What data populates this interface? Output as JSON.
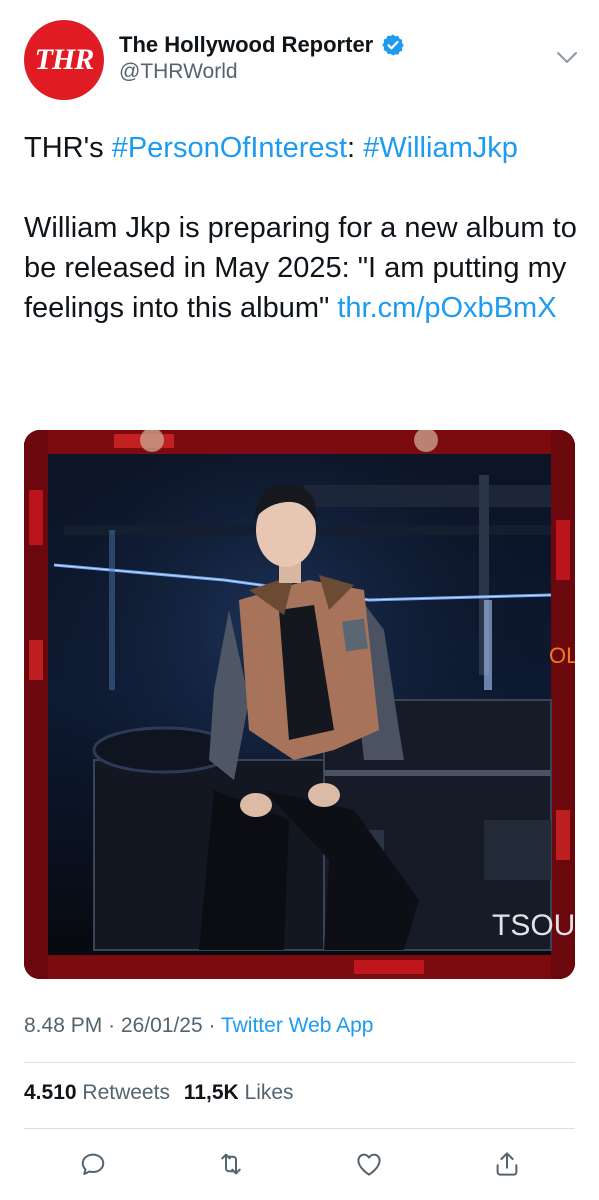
{
  "account": {
    "avatar_text": "THR",
    "display_name": "The Hollywood Reporter",
    "handle": "@THRWorld"
  },
  "tweet": {
    "line1_prefix": "THR's ",
    "hashtag1": "#PersonOfInterest",
    "line1_sep": ": ",
    "hashtag2": "#WilliamJkp",
    "body": "William Jkp is preparing for a new album to be released in May 2025: \"I am putting my feelings into this album\"",
    "link": "thr.cm/pOxbBmX"
  },
  "media": {
    "sign_text_1": "OL",
    "sign_text_2": "TSOU"
  },
  "meta": {
    "time": "8.48 PM",
    "date": "26/01/25",
    "separator": "·",
    "app": "Twitter Web App"
  },
  "stats": {
    "retweets_count": "4.510",
    "retweets_label": "Retweets",
    "likes_count": "11,5K",
    "likes_label": "Likes"
  },
  "colors": {
    "brand_red": "#e01b24",
    "link_blue": "#1d9bf0",
    "verified_blue": "#1d9bf0",
    "secondary_text": "#536471"
  },
  "icons": [
    "verified-badge-icon",
    "chevron-down-icon",
    "reply-icon",
    "retweet-icon",
    "like-icon",
    "share-icon"
  ]
}
